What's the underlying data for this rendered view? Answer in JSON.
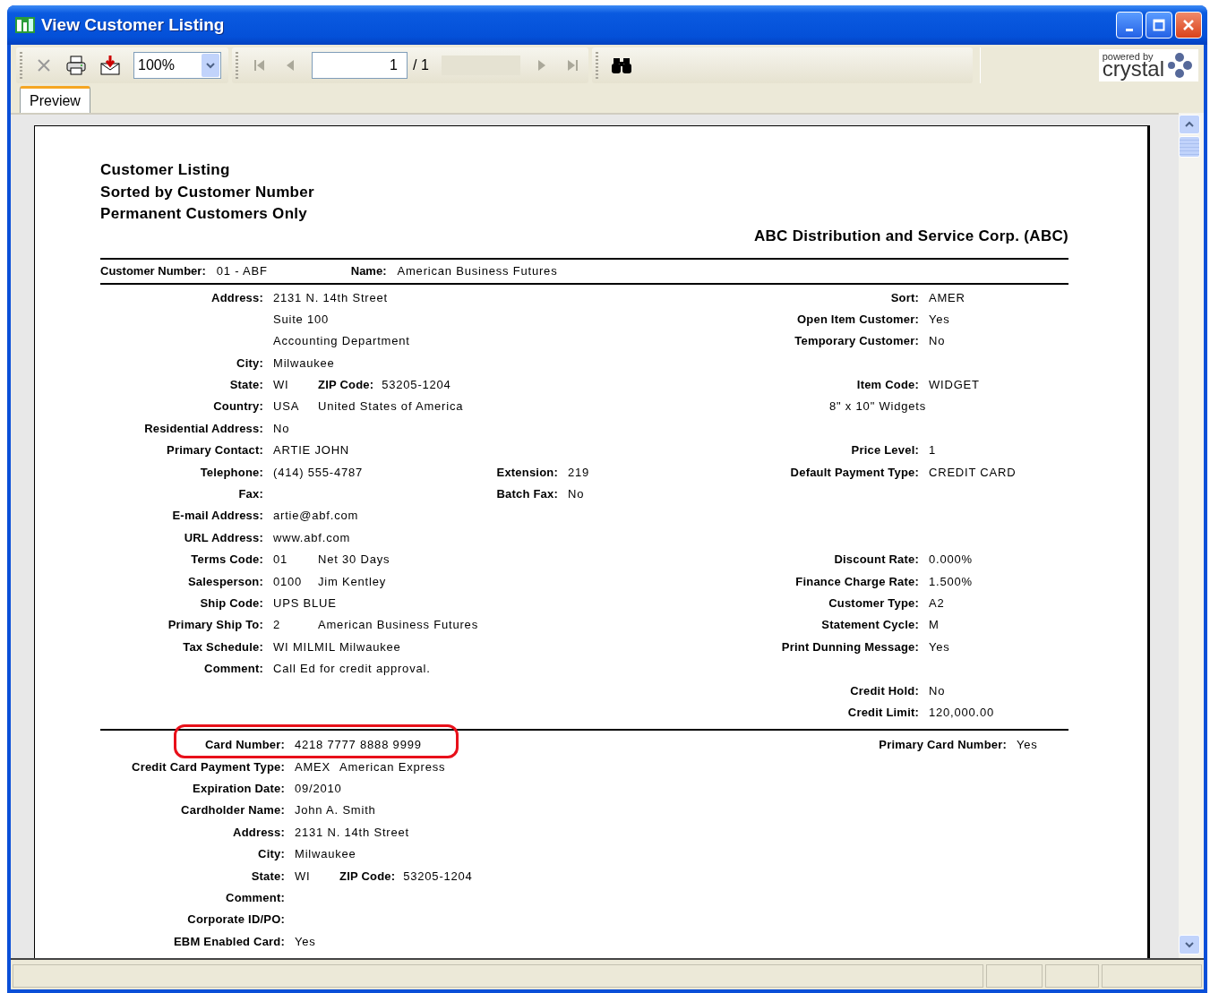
{
  "window": {
    "title": "View Customer Listing"
  },
  "toolbar": {
    "zoom": "100%",
    "page": "1",
    "page_total": "/ 1"
  },
  "logo": {
    "small": "powered by",
    "big": "crystal"
  },
  "tabs": [
    {
      "label": "Preview",
      "selected": true
    }
  ],
  "report": {
    "title_lines": [
      "Customer Listing",
      "Sorted by Customer Number",
      "Permanent Customers Only"
    ],
    "company": "ABC Distribution and Service Corp. (ABC)",
    "header": [
      {
        "label": "Customer Number:",
        "value": "01 - ABF"
      },
      {
        "label": "Name:",
        "value": "American Business Futures"
      }
    ],
    "sections": [
      {
        "rows": [
          {
            "left": {
              "label": "Address:",
              "values": [
                "2131 N. 14th Street"
              ]
            },
            "right": {
              "label": "Sort:",
              "value": "AMER"
            }
          },
          {
            "left": {
              "values": [
                "Suite 100"
              ]
            },
            "right": {
              "label": "Open Item Customer:",
              "value": "Yes"
            }
          },
          {
            "left": {
              "values": [
                "Accounting Department"
              ]
            },
            "right": {
              "label": "Temporary Customer:",
              "value": "No"
            }
          },
          {
            "left": {
              "label": "City:",
              "values": [
                "Milwaukee"
              ]
            }
          },
          {
            "left": {
              "label": "State:",
              "values": [
                "WI"
              ],
              "extra": {
                "label": "ZIP Code:",
                "value": "53205-1204"
              }
            },
            "right": {
              "label": "Item Code:",
              "value": "WIDGET"
            }
          },
          {
            "left": {
              "label": "Country:",
              "values": [
                "USA",
                "United States of America"
              ]
            },
            "right_note": "8\" x 10\" Widgets"
          },
          {
            "left": {
              "label": "Residential Address:",
              "values": [
                "No"
              ]
            }
          },
          {
            "left": {
              "label": "Primary Contact:",
              "values": [
                "ARTIE JOHN"
              ]
            },
            "right": {
              "label": "Price Level:",
              "value": "1"
            }
          },
          {
            "left": {
              "label": "Telephone:",
              "values": [
                "(414) 555-4787"
              ]
            },
            "middle": {
              "label": "Extension:",
              "value": "219"
            },
            "right": {
              "label": "Default Payment Type:",
              "value": "CREDIT CARD"
            }
          },
          {
            "left": {
              "label": "Fax:"
            },
            "middle": {
              "label": "Batch Fax:",
              "value": "No"
            }
          },
          {
            "left": {
              "label": "E-mail Address:",
              "values": [
                "artie@abf.com"
              ]
            }
          },
          {
            "left": {
              "label": "URL Address:",
              "values": [
                "www.abf.com"
              ]
            }
          },
          {
            "left": {
              "label": "Terms Code:",
              "values": [
                "01",
                "Net 30 Days"
              ]
            },
            "right": {
              "label": "Discount Rate:",
              "value": "0.000%"
            }
          },
          {
            "left": {
              "label": "Salesperson:",
              "values": [
                "0100",
                "Jim Kentley"
              ]
            },
            "right": {
              "label": "Finance Charge Rate:",
              "value": "1.500%"
            }
          },
          {
            "left": {
              "label": "Ship Code:",
              "values": [
                "UPS BLUE"
              ]
            },
            "right": {
              "label": "Customer Type:",
              "value": "A2"
            }
          },
          {
            "left": {
              "label": "Primary Ship To:",
              "values": [
                "2",
                "American Business Futures"
              ]
            },
            "right": {
              "label": "Statement Cycle:",
              "value": "M"
            }
          },
          {
            "left": {
              "label": "Tax Schedule:",
              "values": [
                "WI MILMIL Milwaukee"
              ]
            },
            "right": {
              "label": "Print Dunning Message:",
              "value": "Yes"
            }
          },
          {
            "left": {
              "label": "Comment:",
              "values": [
                "Call Ed for credit approval."
              ]
            }
          },
          {
            "right": {
              "label": "Credit Hold:",
              "value": "No"
            }
          },
          {
            "right": {
              "label": "Credit Limit:",
              "value": "120,000.00"
            }
          }
        ]
      },
      {
        "rows": [
          {
            "left": {
              "label": "Card Number:",
              "values": [
                "4218 7777 8888 9999"
              ],
              "highlighted": true
            },
            "right": {
              "label": "Primary Card Number:",
              "value": "Yes"
            }
          },
          {
            "left": {
              "label": "Credit Card Payment Type:",
              "values": [
                "AMEX",
                "American Express"
              ]
            }
          },
          {
            "left": {
              "label": "Expiration Date:",
              "values": [
                "09/2010"
              ]
            }
          },
          {
            "left": {
              "label": "Cardholder Name:",
              "values": [
                "John A. Smith"
              ]
            }
          },
          {
            "left": {
              "label": "Address:",
              "values": [
                "2131 N. 14th Street"
              ]
            }
          },
          {
            "left": {
              "label": "City:",
              "values": [
                "Milwaukee"
              ]
            }
          },
          {
            "left": {
              "label": "State:",
              "values": [
                "WI"
              ],
              "extra": {
                "label": "ZIP Code:",
                "value": "53205-1204"
              }
            }
          },
          {
            "left": {
              "label": "Comment:"
            }
          },
          {
            "left": {
              "label": "Corporate ID/PO:"
            }
          },
          {
            "left": {
              "label": "EBM Enabled Card:",
              "values": [
                "Yes"
              ]
            }
          }
        ]
      }
    ]
  }
}
